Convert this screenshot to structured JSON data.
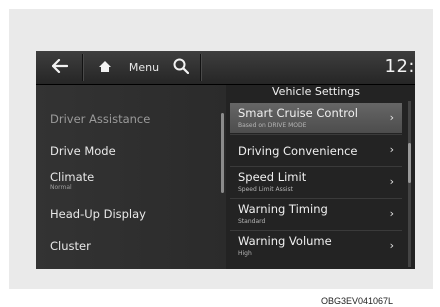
{
  "topbar": {
    "back_icon": "back-arrow-icon",
    "home_icon": "home-icon",
    "menu_label": "Menu",
    "search_icon": "search-icon",
    "clock": "12:"
  },
  "panel": {
    "title": "Vehicle Settings"
  },
  "left_menu": [
    {
      "label": "Driver Assistance",
      "sub": ""
    },
    {
      "label": "Drive Mode",
      "sub": ""
    },
    {
      "label": "Climate",
      "sub": "Normal"
    },
    {
      "label": "Head-Up Display",
      "sub": ""
    },
    {
      "label": "Cluster",
      "sub": ""
    }
  ],
  "right_menu": [
    {
      "label": "Smart Cruise Control",
      "sub": "Based on DRIVE MODE",
      "arrow": "›"
    },
    {
      "label": "Driving Convenience",
      "sub": "",
      "arrow": "›"
    },
    {
      "label": "Speed Limit",
      "sub": "Speed Limit Assist",
      "arrow": "›"
    },
    {
      "label": "Warning Timing",
      "sub": "Standard",
      "arrow": "›"
    },
    {
      "label": "Warning Volume",
      "sub": "High",
      "arrow": "›"
    }
  ],
  "caption": "OBG3EV041067L",
  "colors": {
    "screen_bg": "#232323",
    "selected_row": "#5a5a5a",
    "frame_bg": "#eaeaea"
  }
}
